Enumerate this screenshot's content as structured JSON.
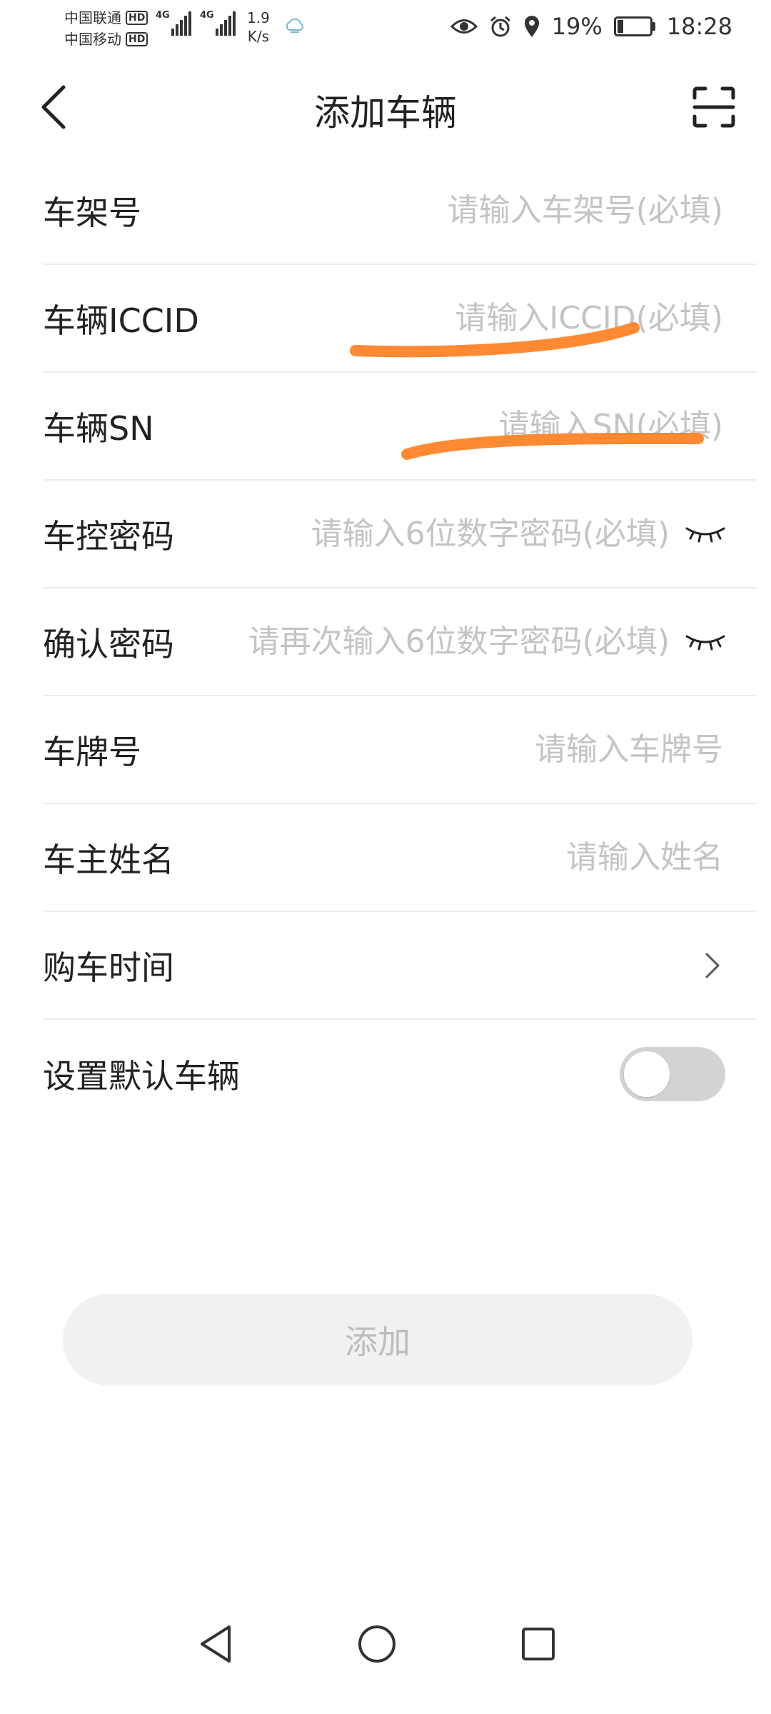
{
  "status_bar": {
    "carrier_1": "中国联通",
    "carrier_2": "中国移动",
    "hd_label": "HD",
    "network_1": "4G",
    "network_2": "4G",
    "speed_value": "1.9",
    "speed_unit": "K/s",
    "battery_text": "19%",
    "battery_level": 0.19,
    "time": "18:28"
  },
  "header": {
    "title": "添加车辆"
  },
  "form": {
    "rows": [
      {
        "label": "车架号",
        "placeholder": "请输入车架号(必填)"
      },
      {
        "label": "车辆ICCID",
        "placeholder": "请输入ICCID(必填)"
      },
      {
        "label": "车辆SN",
        "placeholder": "请输入SN(必填)"
      },
      {
        "label": "车控密码",
        "placeholder": "请输入6位数字密码(必填)"
      },
      {
        "label": "确认密码",
        "placeholder": "请再次输入6位数字密码(必填)"
      },
      {
        "label": "车牌号",
        "placeholder": "请输入车牌号"
      },
      {
        "label": "车主姓名",
        "placeholder": "请输入姓名"
      },
      {
        "label": "购车时间"
      },
      {
        "label": "设置默认车辆",
        "toggle_on": false
      }
    ]
  },
  "submit": {
    "label": "添加"
  },
  "colors": {
    "highlight": "#ff8a33",
    "placeholder": "#c4c4c4",
    "divider": "#ececec",
    "toggle_off": "#d3d3d3",
    "button_bg": "#f1f1f1",
    "button_text": "#bdbdbd"
  },
  "icons": {
    "back": "chevron-left-icon",
    "scan": "scan-icon",
    "eye": "eye-closed-icon",
    "chevron": "chevron-right-icon",
    "nav_back": "triangle-back-icon",
    "nav_home": "circle-home-icon",
    "nav_recent": "square-recent-icon"
  }
}
